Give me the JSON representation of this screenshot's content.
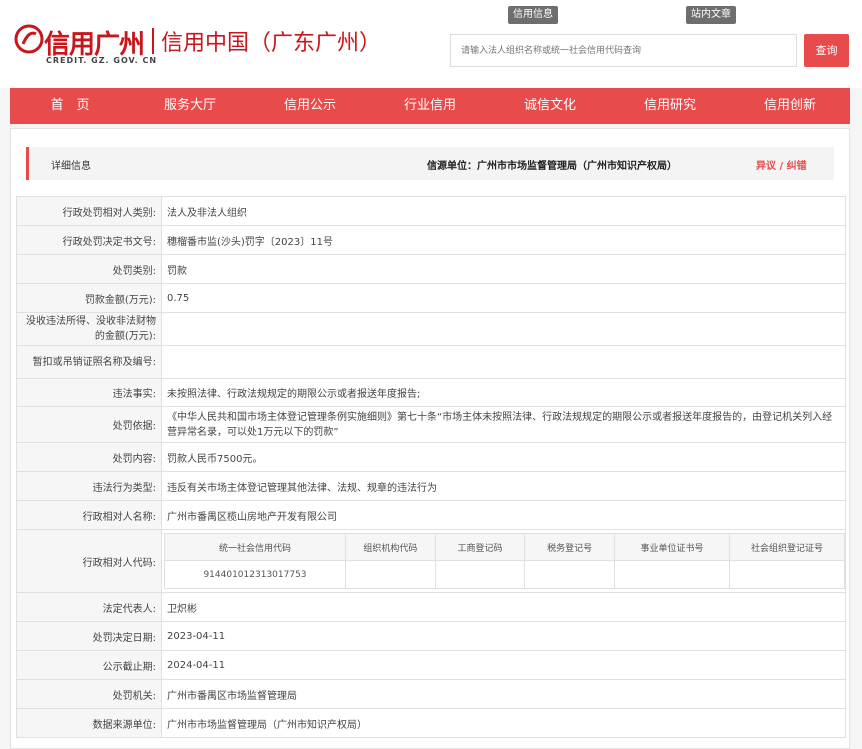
{
  "brand": {
    "logo_text": "信用广州",
    "logo_right": "信用中国（广东广州）",
    "domain": "CREDIT. GZ. GOV. CN"
  },
  "top_tabs": [
    "信用信息",
    "站内文章"
  ],
  "search": {
    "placeholder": "请输入法人组织名称或统一社会信用代码查询",
    "button": "查询"
  },
  "nav": [
    "首　页",
    "服务大厅",
    "信用公示",
    "行业信用",
    "诚信文化",
    "信用研究",
    "信用创新"
  ],
  "accent_color": "#e84b4b",
  "info_bar": {
    "title": "详细信息",
    "source": "信源单位：广州市市场监督管理局（广州市知识产权局）",
    "objection": "异议 / 纠错"
  },
  "rows": [
    {
      "label": "行政处罚相对人类别:",
      "value": "法人及非法人组织"
    },
    {
      "label": "行政处罚决定书文号:",
      "value": "穗榴番市监(沙头)罚字〔2023〕11号"
    },
    {
      "label": "处罚类别:",
      "value": "罚款"
    },
    {
      "label": "罚款金额(万元):",
      "value": "0.75"
    },
    {
      "label": "没收违法所得、没收非法财物的金额(万元):",
      "value": ""
    },
    {
      "label": "暂扣或吊销证照名称及编号:",
      "value": ""
    },
    {
      "label": "违法事实:",
      "value": "未按照法律、行政法规规定的期限公示或者报送年度报告;"
    },
    {
      "label": "处罚依据:",
      "value": "《中华人民共和国市场主体登记管理条例实施细则》第七十条“市场主体未按照法律、行政法规规定的期限公示或者报送年度报告的，由登记机关列入经营异常名录，可以处1万元以下的罚款”"
    },
    {
      "label": "处罚内容:",
      "value": "罚款人民币7500元。"
    },
    {
      "label": "违法行为类型:",
      "value": "违反有关市场主体登记管理其他法律、法规、规章的违法行为"
    },
    {
      "label": "行政相对人名称:",
      "value": "广州市番禺区榄山房地产开发有限公司"
    }
  ],
  "code_row": {
    "label": "行政相对人代码:",
    "headers": [
      "统一社会信用代码",
      "组织机构代码",
      "工商登记码",
      "税务登记号",
      "事业单位证书号",
      "社会组织登记证号"
    ],
    "values": [
      "914401012313017753",
      "",
      "",
      "",
      "",
      ""
    ]
  },
  "rows2": [
    {
      "label": "法定代表人:",
      "value": "卫炽彬"
    },
    {
      "label": "处罚决定日期:",
      "value": "2023-04-11"
    },
    {
      "label": "公示截止期:",
      "value": "2024-04-11"
    },
    {
      "label": "处罚机关:",
      "value": "广州市番禺区市场监督管理局"
    },
    {
      "label": "数据来源单位:",
      "value": "广州市市场监督管理局（广州市知识产权局）"
    }
  ]
}
